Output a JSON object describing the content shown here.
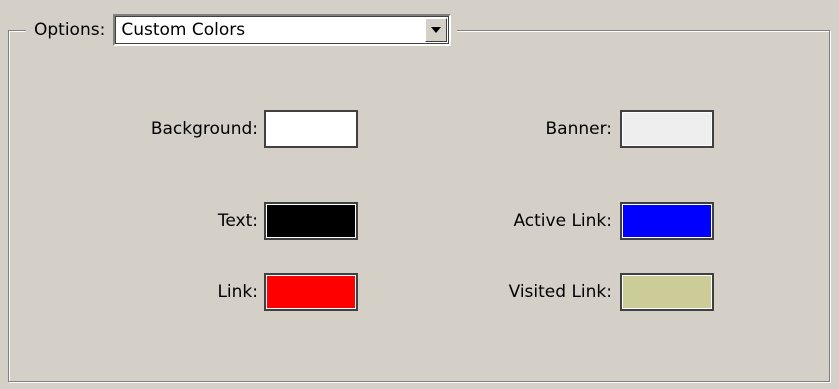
{
  "options": {
    "label": "Options:",
    "selected": "Custom Colors"
  },
  "colors": {
    "background": {
      "label": "Background:",
      "value": "#ffffff"
    },
    "banner": {
      "label": "Banner:",
      "value": "#eeeeee"
    },
    "text": {
      "label": "Text:",
      "value": "#000000"
    },
    "active_link": {
      "label": "Active Link:",
      "value": "#0000ff"
    },
    "link": {
      "label": "Link:",
      "value": "#ff0000"
    },
    "visited_link": {
      "label": "Visited Link:",
      "value": "#cccc99"
    }
  },
  "icons": {
    "dropdown": "chevron-down-icon"
  }
}
